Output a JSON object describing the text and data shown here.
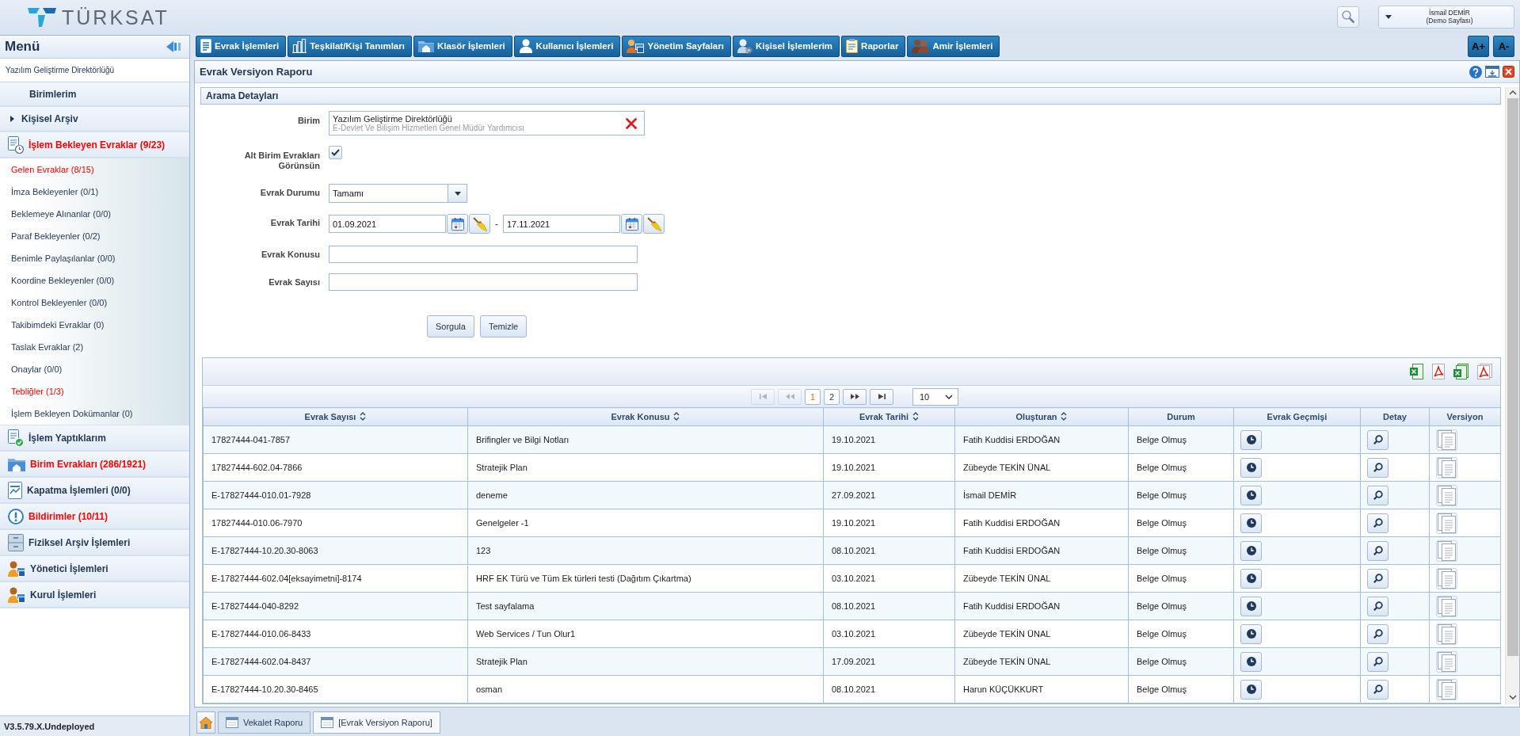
{
  "header": {
    "logo": "TÜRKSAT",
    "user": {
      "name": "İsmail DEMİR",
      "note": "(Demo Sayfası)"
    }
  },
  "sidebar": {
    "title": "Menü",
    "unit": "Yazılım Geliştirme Direktörlüğü",
    "items": [
      {
        "kind": "link",
        "label": "Birimlerim",
        "alert": false
      },
      {
        "kind": "folder",
        "label": "Kişisel Arşiv",
        "alert": false,
        "expanded": false
      },
      {
        "kind": "section",
        "label": "İşlem Bekleyen Evraklar (9/23)",
        "alert": true,
        "expanded": true,
        "children": [
          {
            "label": "Gelen Evraklar (8/15)",
            "alert": true
          },
          {
            "label": "İmza Bekleyenler (0/1)",
            "alert": false
          },
          {
            "label": "Beklemeye Alınanlar (0/0)",
            "alert": false
          },
          {
            "label": "Paraf Bekleyenler (0/2)",
            "alert": false
          },
          {
            "label": "Benimle Paylaşılanlar (0/0)",
            "alert": false
          },
          {
            "label": "Koordine Bekleyenler (0/0)",
            "alert": false
          },
          {
            "label": "Kontrol Bekleyenler (0/0)",
            "alert": false
          },
          {
            "label": "Takibimdeki Evraklar (0)",
            "alert": false
          },
          {
            "label": "Taslak Evraklar (2)",
            "alert": false
          },
          {
            "label": "Onaylar (0/0)",
            "alert": false
          },
          {
            "label": "Tebliğler (1/3)",
            "alert": true
          },
          {
            "label": "İşlem Bekleyen Dokümanlar (0)",
            "alert": false
          }
        ]
      },
      {
        "kind": "section",
        "label": "İşlem Yaptıklarım",
        "alert": false
      },
      {
        "kind": "section",
        "label": "Birim Evrakları (286/1921)",
        "alert": true
      },
      {
        "kind": "section",
        "label": "Kapatma İşlemleri (0/0)",
        "alert": false
      },
      {
        "kind": "section",
        "label": "Bildirimler (10/11)",
        "alert": true
      },
      {
        "kind": "section",
        "label": "Fiziksel Arşiv İşlemleri",
        "alert": false
      },
      {
        "kind": "section",
        "label": "Yönetici İşlemleri",
        "alert": false
      },
      {
        "kind": "section",
        "label": "Kurul İşlemleri",
        "alert": false
      }
    ],
    "version": "V3.5.79.X.Undeployed"
  },
  "toolbar": {
    "tabs": [
      {
        "label": "Evrak İşlemleri"
      },
      {
        "label": "Teşkilat/Kişi Tanımları"
      },
      {
        "label": "Klasör İşlemleri"
      },
      {
        "label": "Kullanıcı İşlemleri"
      },
      {
        "label": "Yönetim Sayfaları"
      },
      {
        "label": "Kişisel İşlemlerim"
      },
      {
        "label": "Raporlar"
      },
      {
        "label": "Amir İşlemleri"
      }
    ],
    "font_buttons": [
      "A+",
      "A-"
    ]
  },
  "panel": {
    "title": "Evrak Versiyon Raporu",
    "search": {
      "title": "Arama Detayları",
      "fields": [
        {
          "kind": "unit",
          "label": "Birim",
          "value": "Yazılım Geliştirme Direktörlüğü",
          "subtitle": "E-Devlet Ve Bilişim Hizmetleri Genel Müdür Yardımcısı"
        },
        {
          "kind": "checkbox",
          "label": "Alt Birim Evrakları Görünsün",
          "checked": true
        },
        {
          "kind": "select",
          "label": "Evrak Durumu",
          "value": "Tamamı"
        },
        {
          "kind": "date_range",
          "label": "Evrak Tarihi",
          "from": "01.09.2021",
          "separator": "-",
          "to": "17.11.2021"
        },
        {
          "kind": "text",
          "label": "Evrak Konusu"
        },
        {
          "kind": "text",
          "label": "Evrak Sayısı"
        }
      ],
      "buttons": [
        "Sorgula",
        "Temizle"
      ]
    },
    "table": {
      "paginator": {
        "nav_back": [
          {
            "kind": "first",
            "disabled": true
          },
          {
            "kind": "prev",
            "disabled": true
          }
        ],
        "pages": [
          {
            "label": "1",
            "selected": true
          },
          {
            "label": "2",
            "selected": false
          }
        ],
        "nav_forward": [
          {
            "kind": "next",
            "disabled": false
          },
          {
            "kind": "last",
            "disabled": false
          }
        ],
        "page_size": "10"
      },
      "columns": [
        {
          "label": "Evrak Sayısı",
          "kind": "text",
          "sortable": true
        },
        {
          "label": "Evrak Konusu",
          "kind": "text",
          "sortable": true
        },
        {
          "label": "Evrak Tarihi",
          "kind": "text",
          "sortable": true
        },
        {
          "label": "Oluşturan",
          "kind": "text",
          "sortable": true
        },
        {
          "label": "Durum",
          "kind": "text",
          "sortable": false
        },
        {
          "label": "Evrak Geçmişi",
          "kind": "history",
          "sortable": false
        },
        {
          "label": "Detay",
          "kind": "detail",
          "sortable": false
        },
        {
          "label": "Versiyon",
          "kind": "version",
          "sortable": false
        }
      ],
      "rows": [
        {
          "cells": [
            "17827444-041-7857",
            "Brifingler ve Bilgi Notları",
            "19.10.2021",
            "Fatih Kuddisi ERDOĞAN",
            "Belge Olmuş"
          ]
        },
        {
          "cells": [
            "17827444-602.04-7866",
            "Stratejik Plan",
            "19.10.2021",
            "Zübeyde TEKİN ÜNAL",
            "Belge Olmuş"
          ]
        },
        {
          "cells": [
            "E-17827444-010.01-7928",
            "deneme",
            "27.09.2021",
            "İsmail DEMİR",
            "Belge Olmuş"
          ]
        },
        {
          "cells": [
            "17827444-010.06-7970",
            "Genelgeler -1",
            "19.10.2021",
            "Fatih Kuddisi ERDOĞAN",
            "Belge Olmuş"
          ]
        },
        {
          "cells": [
            "E-17827444-10.20.30-8063",
            "123",
            "08.10.2021",
            "Fatih Kuddisi ERDOĞAN",
            "Belge Olmuş"
          ]
        },
        {
          "cells": [
            "E-17827444-602.04[eksayimetni]-8174",
            "HRF EK Türü ve Tüm Ek türleri testi (Dağıtım Çıkartma)",
            "03.10.2021",
            "Zübeyde TEKİN ÜNAL",
            "Belge Olmuş"
          ]
        },
        {
          "cells": [
            "E-17827444-040-8292",
            "Test sayfalama",
            "08.10.2021",
            "Fatih Kuddisi ERDOĞAN",
            "Belge Olmuş"
          ]
        },
        {
          "cells": [
            "E-17827444-010.06-8433",
            "Web Services / Tun Olur1",
            "03.10.2021",
            "Zübeyde TEKİN ÜNAL",
            "Belge Olmuş"
          ]
        },
        {
          "cells": [
            "E-17827444-602.04-8437",
            "Stratejik Plan",
            "17.09.2021",
            "Zübeyde TEKİN ÜNAL",
            "Belge Olmuş"
          ]
        },
        {
          "cells": [
            "E-17827444-10.20.30-8465",
            "osman",
            "08.10.2021",
            "Harun KÜÇÜKKURT",
            "Belge Olmuş"
          ]
        }
      ]
    }
  },
  "open_tabs": [
    {
      "label": "Vekalet Raporu",
      "selected": false
    },
    {
      "label": "[Evrak Versiyon Raporu]",
      "selected": true
    }
  ]
}
